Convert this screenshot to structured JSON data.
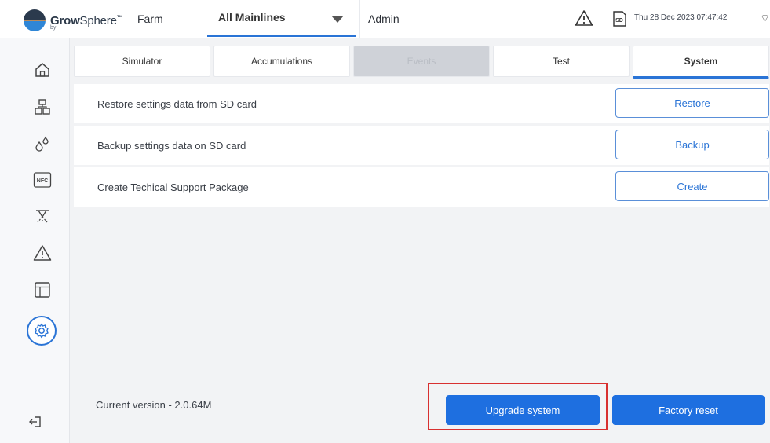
{
  "header": {
    "brand_name_bold": "Grow",
    "brand_name_light": "Sphere",
    "brand_trademark": "™",
    "brand_sub": "by",
    "farm_label": "Farm",
    "mainline_selected": "All Mainlines",
    "user_role": "Admin",
    "datetime": "Thu 28 Dec 2023  07:47:42",
    "sd_label": "SD"
  },
  "sidebar": {
    "items": [
      {
        "icon": "home-icon"
      },
      {
        "icon": "network-icon"
      },
      {
        "icon": "drops-icon"
      },
      {
        "icon": "nfc-icon",
        "label": "NFC"
      },
      {
        "icon": "sprinkler-icon"
      },
      {
        "icon": "warning-icon"
      },
      {
        "icon": "layout-icon"
      },
      {
        "icon": "settings-icon",
        "active": true
      },
      {
        "icon": "logout-icon"
      }
    ]
  },
  "tabs": [
    {
      "label": "Simulator"
    },
    {
      "label": "Accumulations"
    },
    {
      "label": "Events",
      "disabled": true
    },
    {
      "label": "Test"
    },
    {
      "label": "System",
      "active": true
    }
  ],
  "rows": [
    {
      "label": "Restore settings data from SD card",
      "button": "Restore"
    },
    {
      "label": "Backup settings data on SD card",
      "button": "Backup"
    },
    {
      "label": "Create Techical Support Package",
      "button": "Create"
    }
  ],
  "footer": {
    "version": "Current version - 2.0.64M",
    "upgrade_button": "Upgrade system",
    "factory_reset_button": "Factory reset"
  },
  "colors": {
    "accent": "#1e6fe0",
    "highlight": "#d83030",
    "background": "#f2f3f5"
  }
}
